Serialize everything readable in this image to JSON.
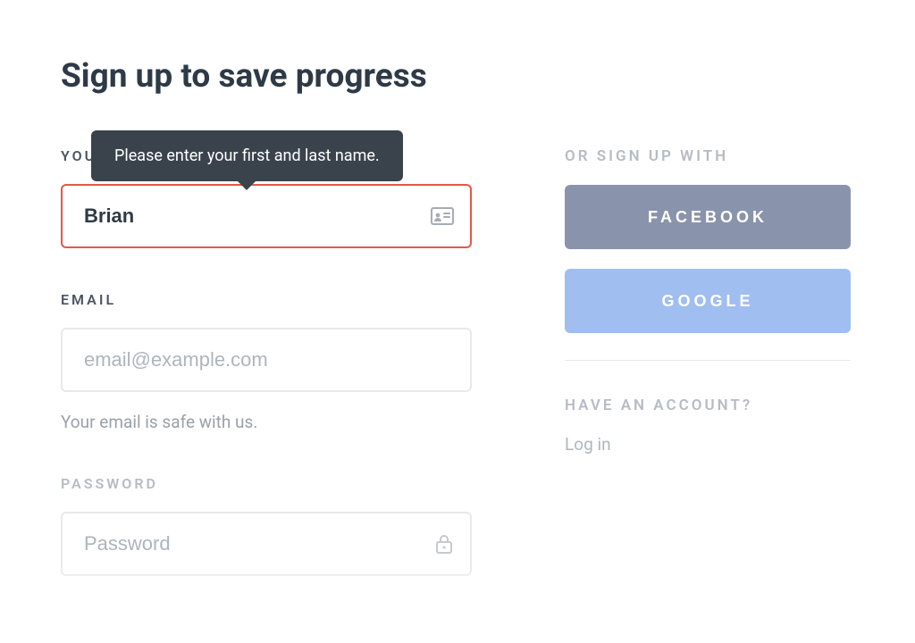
{
  "page": {
    "title": "Sign up to save progress"
  },
  "form": {
    "name": {
      "label": "YOUR NAME",
      "value": "Brian",
      "tooltip": "Please enter your first and last name."
    },
    "email": {
      "label": "EMAIL",
      "placeholder": "email@example.com",
      "helper": "Your email is safe with us."
    },
    "password": {
      "label": "PASSWORD",
      "placeholder": "Password"
    }
  },
  "social": {
    "label": "OR SIGN UP WITH",
    "facebook": "FACEBOOK",
    "google": "GOOGLE"
  },
  "login": {
    "label": "HAVE AN ACCOUNT?",
    "link": "Log in"
  }
}
